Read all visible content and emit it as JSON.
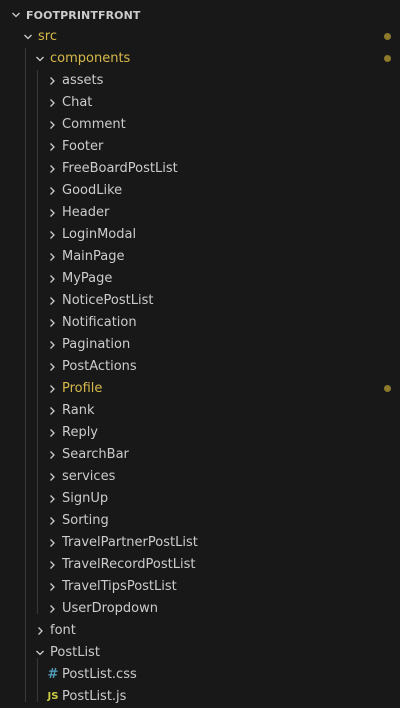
{
  "explorer": {
    "title": "FOOTPRINTFRONT",
    "colors": {
      "background": "#181818",
      "text": "#cccccc",
      "modified_text": "#d7ba4a",
      "modified_dot": "#8d7a2b",
      "css_icon": "#519aba",
      "js_icon": "#cbcb41"
    },
    "tree": [
      {
        "label": "src",
        "kind": "folder",
        "expanded": true,
        "modified": true
      },
      {
        "label": "components",
        "kind": "folder",
        "expanded": true,
        "modified": true
      },
      {
        "label": "assets",
        "kind": "folder",
        "expanded": false
      },
      {
        "label": "Chat",
        "kind": "folder",
        "expanded": false
      },
      {
        "label": "Comment",
        "kind": "folder",
        "expanded": false
      },
      {
        "label": "Footer",
        "kind": "folder",
        "expanded": false
      },
      {
        "label": "FreeBoardPostList",
        "kind": "folder",
        "expanded": false
      },
      {
        "label": "GoodLike",
        "kind": "folder",
        "expanded": false
      },
      {
        "label": "Header",
        "kind": "folder",
        "expanded": false
      },
      {
        "label": "LoginModal",
        "kind": "folder",
        "expanded": false
      },
      {
        "label": "MainPage",
        "kind": "folder",
        "expanded": false
      },
      {
        "label": "MyPage",
        "kind": "folder",
        "expanded": false
      },
      {
        "label": "NoticePostList",
        "kind": "folder",
        "expanded": false
      },
      {
        "label": "Notification",
        "kind": "folder",
        "expanded": false
      },
      {
        "label": "Pagination",
        "kind": "folder",
        "expanded": false
      },
      {
        "label": "PostActions",
        "kind": "folder",
        "expanded": false
      },
      {
        "label": "Profile",
        "kind": "folder",
        "expanded": false,
        "modified": true
      },
      {
        "label": "Rank",
        "kind": "folder",
        "expanded": false
      },
      {
        "label": "Reply",
        "kind": "folder",
        "expanded": false
      },
      {
        "label": "SearchBar",
        "kind": "folder",
        "expanded": false
      },
      {
        "label": "services",
        "kind": "folder",
        "expanded": false
      },
      {
        "label": "SignUp",
        "kind": "folder",
        "expanded": false
      },
      {
        "label": "Sorting",
        "kind": "folder",
        "expanded": false
      },
      {
        "label": "TravelPartnerPostList",
        "kind": "folder",
        "expanded": false
      },
      {
        "label": "TravelRecordPostList",
        "kind": "folder",
        "expanded": false
      },
      {
        "label": "TravelTipsPostList",
        "kind": "folder",
        "expanded": false
      },
      {
        "label": "UserDropdown",
        "kind": "folder",
        "expanded": false
      },
      {
        "label": "font",
        "kind": "folder",
        "expanded": false
      },
      {
        "label": "PostList",
        "kind": "folder",
        "expanded": true
      },
      {
        "label": "PostList.css",
        "kind": "file",
        "icon": "css-file-icon",
        "icon_glyph": "#"
      },
      {
        "label": "PostList.js",
        "kind": "file",
        "icon": "js-file-icon",
        "icon_glyph": "JS"
      }
    ]
  }
}
